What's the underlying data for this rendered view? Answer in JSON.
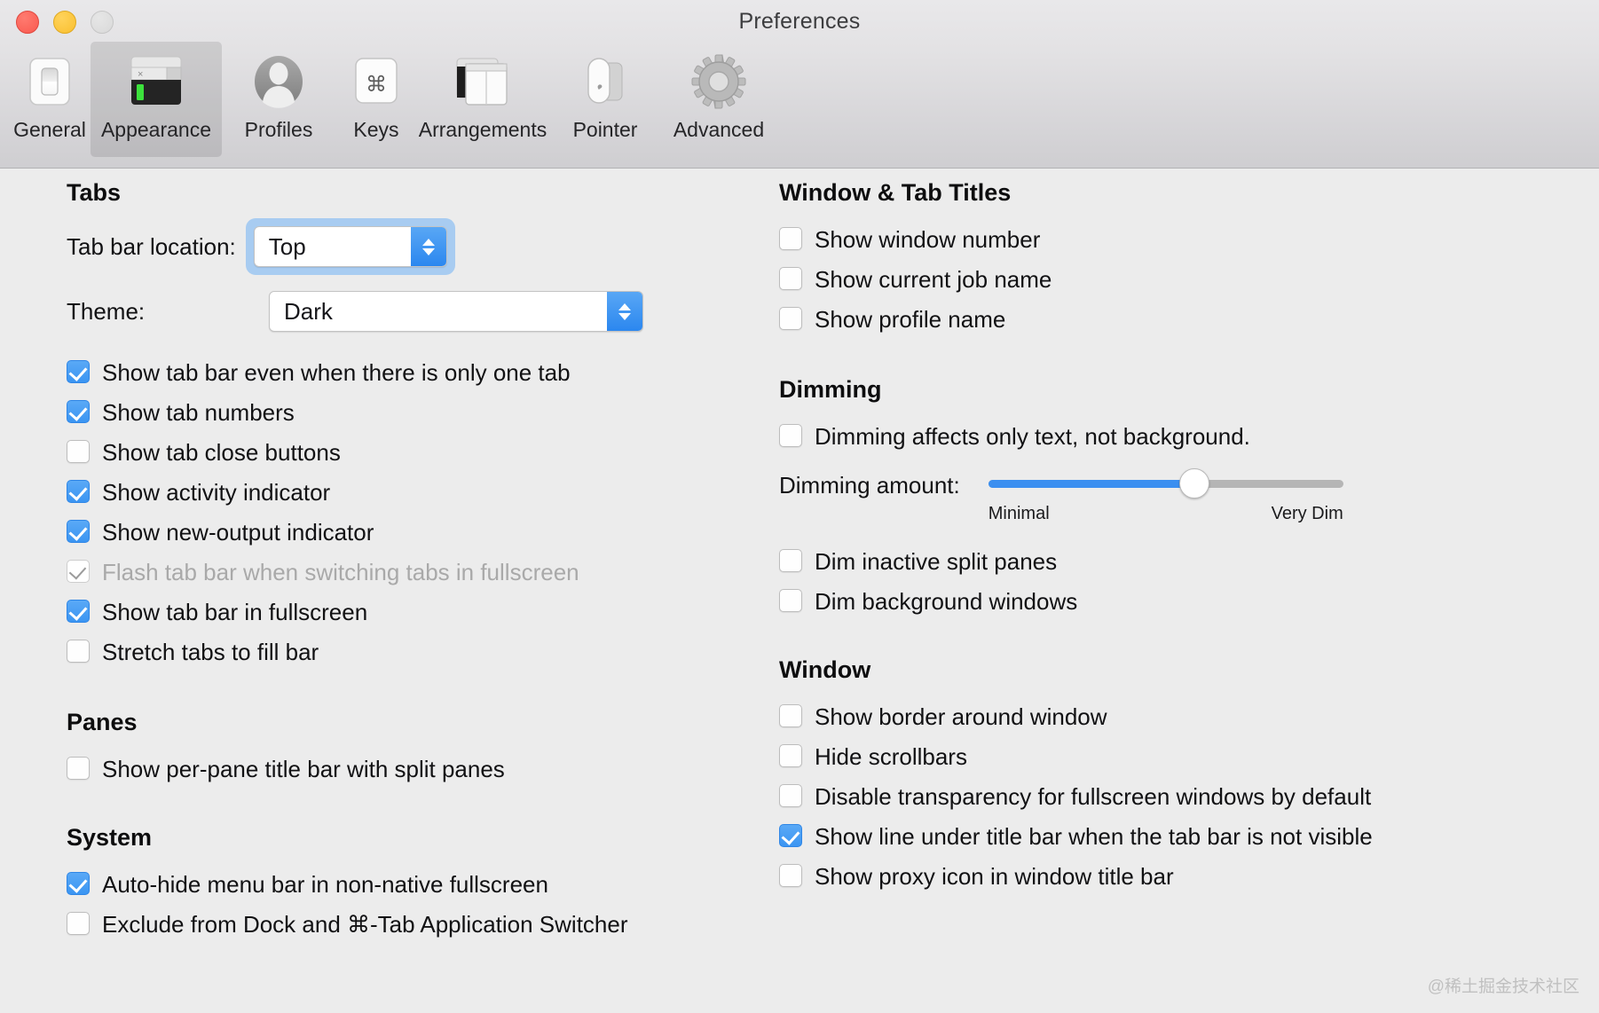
{
  "window": {
    "title": "Preferences",
    "traffic_lights": [
      "close",
      "minimize",
      "zoom"
    ]
  },
  "toolbar": {
    "items": [
      {
        "label": "General",
        "icon": "toggle-switch-icon",
        "selected": false
      },
      {
        "label": "Appearance",
        "icon": "terminal-window-icon",
        "selected": true
      },
      {
        "label": "Profiles",
        "icon": "person-silhouette-icon",
        "selected": false
      },
      {
        "label": "Keys",
        "icon": "command-key-icon",
        "selected": false
      },
      {
        "label": "Arrangements",
        "icon": "stacked-windows-icon",
        "selected": false
      },
      {
        "label": "Pointer",
        "icon": "mouse-icon",
        "selected": false
      },
      {
        "label": "Advanced",
        "icon": "gear-icon",
        "selected": false
      }
    ]
  },
  "left_column": {
    "tabs": {
      "heading": "Tabs",
      "tab_bar_location": {
        "label": "Tab bar location:",
        "value": "Top",
        "focused": true
      },
      "theme": {
        "label": "Theme:",
        "value": "Dark",
        "focused": false
      },
      "checkboxes": [
        {
          "label": "Show tab bar even when there is only one tab",
          "checked": true,
          "disabled": false
        },
        {
          "label": "Show tab numbers",
          "checked": true,
          "disabled": false
        },
        {
          "label": "Show tab close buttons",
          "checked": false,
          "disabled": false
        },
        {
          "label": "Show activity indicator",
          "checked": true,
          "disabled": false
        },
        {
          "label": "Show new-output indicator",
          "checked": true,
          "disabled": false
        },
        {
          "label": "Flash tab bar when switching tabs in fullscreen",
          "checked": true,
          "disabled": true
        },
        {
          "label": "Show tab bar in fullscreen",
          "checked": true,
          "disabled": false
        },
        {
          "label": "Stretch tabs to fill bar",
          "checked": false,
          "disabled": false
        }
      ]
    },
    "panes": {
      "heading": "Panes",
      "checkboxes": [
        {
          "label": "Show per-pane title bar with split panes",
          "checked": false,
          "disabled": false
        }
      ]
    },
    "system": {
      "heading": "System",
      "checkboxes": [
        {
          "label": "Auto-hide menu bar in non-native fullscreen",
          "checked": true,
          "disabled": false
        },
        {
          "label": "Exclude from Dock and ⌘-Tab Application Switcher",
          "checked": false,
          "disabled": false
        }
      ]
    }
  },
  "right_column": {
    "window_tab_titles": {
      "heading": "Window & Tab Titles",
      "checkboxes": [
        {
          "label": "Show window number",
          "checked": false,
          "disabled": false
        },
        {
          "label": "Show current job name",
          "checked": false,
          "disabled": false
        },
        {
          "label": "Show profile name",
          "checked": false,
          "disabled": false
        }
      ]
    },
    "dimming": {
      "heading": "Dimming",
      "checkbox_top": {
        "label": "Dimming affects only text, not background.",
        "checked": false,
        "disabled": false
      },
      "slider": {
        "label": "Dimming amount:",
        "min_label": "Minimal",
        "max_label": "Very Dim",
        "value_percent": 58
      },
      "checkboxes": [
        {
          "label": "Dim inactive split panes",
          "checked": false,
          "disabled": false
        },
        {
          "label": "Dim background windows",
          "checked": false,
          "disabled": false
        }
      ]
    },
    "window": {
      "heading": "Window",
      "checkboxes": [
        {
          "label": "Show border around window",
          "checked": false,
          "disabled": false
        },
        {
          "label": "Hide scrollbars",
          "checked": false,
          "disabled": false
        },
        {
          "label": "Disable transparency for fullscreen windows by default",
          "checked": false,
          "disabled": false
        },
        {
          "label": "Show line under title bar when the tab bar is not visible",
          "checked": true,
          "disabled": false
        },
        {
          "label": "Show proxy icon in window title bar",
          "checked": false,
          "disabled": false
        }
      ]
    }
  },
  "watermark": "@稀土掘金技术社区",
  "colors": {
    "accent_blue": "#3b95f2",
    "focus_ring": "#9cc7f2",
    "toolbar_selected": "rgba(0,0,0,0.10)",
    "content_bg": "#ececec"
  }
}
